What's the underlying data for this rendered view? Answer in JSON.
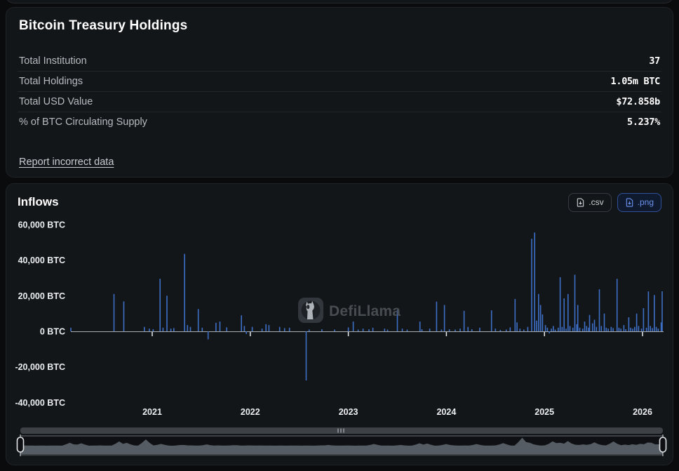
{
  "treasury_panel": {
    "title": "Bitcoin Treasury Holdings",
    "rows": [
      {
        "label": "Total Institution",
        "value": "37"
      },
      {
        "label": "Total Holdings",
        "value": "1.05m BTC"
      },
      {
        "label": "Total USD Value",
        "value": "$72.858b"
      },
      {
        "label": "% of BTC Circulating Supply",
        "value": "5.237%"
      }
    ],
    "report_link": "Report incorrect data"
  },
  "chart_panel": {
    "title": "Inflows",
    "csv_button": ".csv",
    "png_button": ".png",
    "watermark": "DefiLlama"
  },
  "colors": {
    "bar": "#3d6fc7",
    "axis_line": "#a9adb2",
    "tick": "#e8eaec",
    "minimap_fill": "#636a72",
    "accent_blue": "#6a93f0"
  },
  "chart_data": {
    "type": "bar",
    "title": "Inflows",
    "unit": "BTC",
    "y_ticks": [
      "60,000 BTC",
      "40,000 BTC",
      "20,000 BTC",
      "0 BTC",
      "-20,000 BTC",
      "-40,000 BTC"
    ],
    "y_tick_values": [
      60000,
      40000,
      20000,
      0,
      -20000,
      -40000
    ],
    "ylim": [
      -48000,
      64000
    ],
    "x_ticks": [
      "2021",
      "2022",
      "2023",
      "2024",
      "2025",
      "2026"
    ],
    "x_range_years": [
      2020.15,
      2026.21
    ],
    "grid": false,
    "legend": false,
    "points": [
      [
        2020.17,
        2000
      ],
      [
        2020.61,
        21000
      ],
      [
        2020.71,
        16800
      ],
      [
        2020.92,
        2500
      ],
      [
        2020.97,
        1500
      ],
      [
        2021.01,
        1200
      ],
      [
        2021.08,
        29500
      ],
      [
        2021.11,
        2000
      ],
      [
        2021.15,
        20000
      ],
      [
        2021.19,
        1500
      ],
      [
        2021.22,
        1800
      ],
      [
        2021.33,
        43500
      ],
      [
        2021.36,
        3500
      ],
      [
        2021.39,
        2500
      ],
      [
        2021.47,
        12500
      ],
      [
        2021.51,
        2000
      ],
      [
        2021.57,
        -4500
      ],
      [
        2021.65,
        4800
      ],
      [
        2021.69,
        5500
      ],
      [
        2021.76,
        2200
      ],
      [
        2021.91,
        9000
      ],
      [
        2021.94,
        3000
      ],
      [
        2021.96,
        -1500
      ],
      [
        2022.02,
        2500
      ],
      [
        2022.12,
        1500
      ],
      [
        2022.16,
        4000
      ],
      [
        2022.19,
        3500
      ],
      [
        2022.3,
        2500
      ],
      [
        2022.35,
        1800
      ],
      [
        2022.4,
        2000
      ],
      [
        2022.57,
        -27600
      ],
      [
        2022.6,
        1000
      ],
      [
        2022.73,
        1200
      ],
      [
        2022.86,
        1000
      ],
      [
        2023.0,
        2200
      ],
      [
        2023.05,
        5500
      ],
      [
        2023.1,
        1000
      ],
      [
        2023.15,
        1500
      ],
      [
        2023.21,
        1200
      ],
      [
        2023.25,
        2000
      ],
      [
        2023.37,
        1500
      ],
      [
        2023.4,
        1000
      ],
      [
        2023.5,
        12000
      ],
      [
        2023.55,
        1500
      ],
      [
        2023.6,
        1000
      ],
      [
        2023.73,
        5500
      ],
      [
        2023.75,
        1200
      ],
      [
        2023.83,
        1500
      ],
      [
        2023.9,
        16700
      ],
      [
        2023.95,
        1000
      ],
      [
        2023.98,
        14800
      ],
      [
        2024.03,
        1200
      ],
      [
        2024.09,
        1000
      ],
      [
        2024.14,
        1500
      ],
      [
        2024.18,
        11500
      ],
      [
        2024.22,
        2500
      ],
      [
        2024.26,
        1200
      ],
      [
        2024.34,
        2000
      ],
      [
        2024.46,
        11800
      ],
      [
        2024.5,
        1500
      ],
      [
        2024.55,
        800
      ],
      [
        2024.61,
        1000
      ],
      [
        2024.65,
        2200
      ],
      [
        2024.7,
        18200
      ],
      [
        2024.72,
        5000
      ],
      [
        2024.75,
        1500
      ],
      [
        2024.79,
        1000
      ],
      [
        2024.83,
        2500
      ],
      [
        2024.87,
        52000
      ],
      [
        2024.9,
        55500
      ],
      [
        2024.92,
        6000
      ],
      [
        2024.94,
        21000
      ],
      [
        2024.96,
        14800
      ],
      [
        2024.98,
        9500
      ],
      [
        2025.01,
        3500
      ],
      [
        2025.03,
        2000
      ],
      [
        2025.05,
        -1200
      ],
      [
        2025.07,
        1500
      ],
      [
        2025.09,
        3000
      ],
      [
        2025.11,
        1000
      ],
      [
        2025.14,
        2000
      ],
      [
        2025.16,
        30400
      ],
      [
        2025.18,
        2500
      ],
      [
        2025.2,
        18500
      ],
      [
        2025.22,
        1500
      ],
      [
        2025.24,
        21000
      ],
      [
        2025.26,
        3000
      ],
      [
        2025.29,
        2000
      ],
      [
        2025.31,
        31800
      ],
      [
        2025.33,
        4000
      ],
      [
        2025.34,
        14800
      ],
      [
        2025.36,
        2000
      ],
      [
        2025.39,
        1500
      ],
      [
        2025.41,
        5500
      ],
      [
        2025.43,
        3000
      ],
      [
        2025.45,
        2000
      ],
      [
        2025.46,
        9200
      ],
      [
        2025.49,
        4500
      ],
      [
        2025.51,
        6500
      ],
      [
        2025.53,
        2500
      ],
      [
        2025.56,
        23600
      ],
      [
        2025.58,
        3000
      ],
      [
        2025.61,
        10000
      ],
      [
        2025.63,
        2000
      ],
      [
        2025.65,
        1500
      ],
      [
        2025.68,
        2500
      ],
      [
        2025.7,
        1800
      ],
      [
        2025.74,
        29500
      ],
      [
        2025.76,
        2000
      ],
      [
        2025.78,
        1500
      ],
      [
        2025.81,
        3500
      ],
      [
        2025.83,
        1200
      ],
      [
        2025.86,
        7900
      ],
      [
        2025.88,
        2000
      ],
      [
        2025.9,
        1500
      ],
      [
        2025.92,
        2500
      ],
      [
        2025.94,
        10000
      ],
      [
        2025.96,
        3000
      ],
      [
        2025.99,
        1500
      ],
      [
        2026.01,
        13000
      ],
      [
        2026.04,
        2000
      ],
      [
        2026.06,
        22400
      ],
      [
        2026.08,
        3000
      ],
      [
        2026.1,
        1800
      ],
      [
        2026.12,
        20400
      ],
      [
        2026.14,
        2500
      ],
      [
        2026.16,
        1500
      ],
      [
        2026.19,
        5000
      ],
      [
        2026.2,
        22500
      ]
    ]
  }
}
